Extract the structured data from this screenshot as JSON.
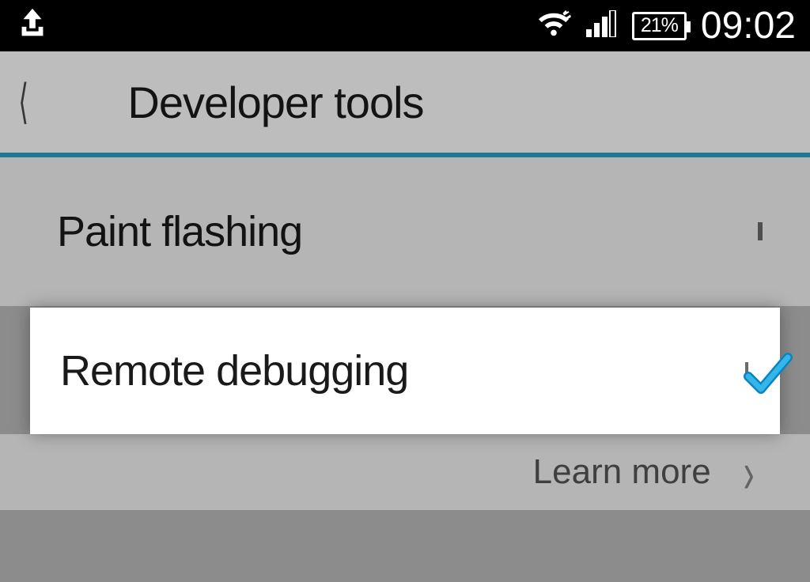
{
  "status": {
    "battery_percent": "21%",
    "time": "09:02"
  },
  "header": {
    "title": "Developer tools"
  },
  "settings": {
    "paint_flashing": {
      "label": "Paint flashing",
      "checked": false
    },
    "remote_debugging": {
      "label": "Remote debugging",
      "checked": true
    },
    "learn_more": "Learn more"
  }
}
